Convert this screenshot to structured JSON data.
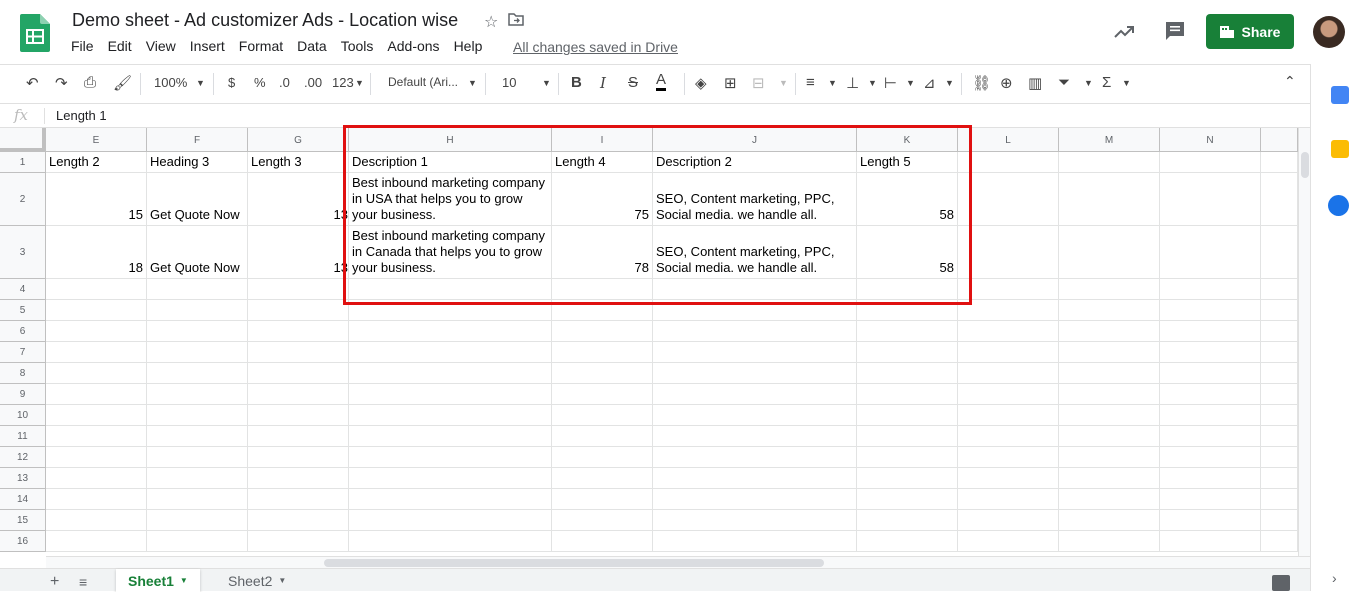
{
  "app": {
    "title": "Demo sheet - Ad customizer Ads - Location wise",
    "saved_status": "All changes saved in Drive",
    "share_label": "Share",
    "menu": [
      "File",
      "Edit",
      "View",
      "Insert",
      "Format",
      "Data",
      "Tools",
      "Add-ons",
      "Help"
    ]
  },
  "toolbar": {
    "zoom": "100%",
    "currency": "$",
    "percent": "%",
    "decrease_decimal": ".0",
    "increase_decimal": ".00",
    "more_formats": "123",
    "font": "Default (Ari...",
    "font_size": "10",
    "bold": "B",
    "italic": "I",
    "strike": "S",
    "text_color": "A"
  },
  "formula_bar": {
    "fx": "fx",
    "value": "Length 1"
  },
  "columns": [
    "E",
    "F",
    "G",
    "H",
    "I",
    "J",
    "K",
    "L",
    "M",
    "N"
  ],
  "rows": [
    "1",
    "2",
    "3",
    "4",
    "5",
    "6",
    "7",
    "8",
    "9",
    "10",
    "11",
    "12",
    "13",
    "14",
    "15",
    "16"
  ],
  "cells": {
    "E1": "Length 2",
    "F1": "Heading 3",
    "G1": "Length 3",
    "H1": "Description 1",
    "I1": "Length 4",
    "J1": "Description 2",
    "K1": "Length 5",
    "E2": "15",
    "F2": "Get Quote Now",
    "G2": "13",
    "H2": "Best inbound marketing company in USA that helps you to grow your business.",
    "I2": "75",
    "J2": "SEO, Content marketing, PPC, Social media. we handle all.",
    "K2": "58",
    "E3": "18",
    "F3": "Get Quote Now",
    "G3": "13",
    "H3": "Best inbound marketing company in Canada that helps you to grow your business.",
    "I3": "78",
    "J3": "SEO, Content marketing, PPC, Social media. we handle all.",
    "K3": "58"
  },
  "sheets": [
    {
      "name": "Sheet1",
      "active": true
    },
    {
      "name": "Sheet2",
      "active": false
    }
  ],
  "colors": {
    "share_green": "#188038",
    "highlight_red": "#e01010"
  }
}
